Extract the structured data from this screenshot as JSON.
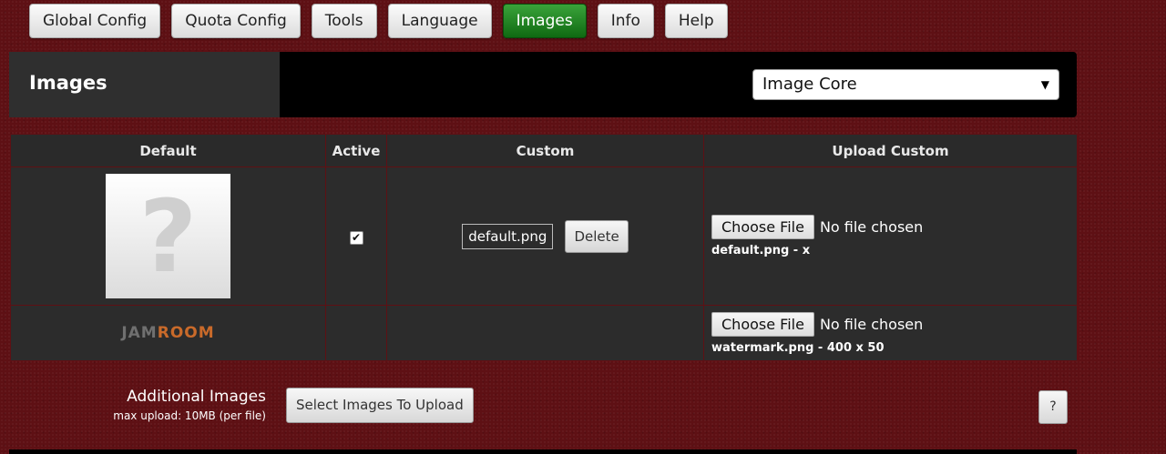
{
  "tabs": [
    {
      "label": "Global Config",
      "active": false
    },
    {
      "label": "Quota Config",
      "active": false
    },
    {
      "label": "Tools",
      "active": false
    },
    {
      "label": "Language",
      "active": false
    },
    {
      "label": "Images",
      "active": true
    },
    {
      "label": "Info",
      "active": false
    },
    {
      "label": "Help",
      "active": false
    }
  ],
  "header": {
    "title": "Images",
    "module_select_value": "Image Core"
  },
  "table": {
    "columns": [
      "Default",
      "Active",
      "Custom",
      "Upload Custom"
    ],
    "rows": [
      {
        "default_icon": "question-mark-icon",
        "default_text": "?",
        "active_check": "✔",
        "custom_image_alt": "default.png",
        "delete_label": "Delete",
        "choose_label": "Choose File",
        "no_file": "No file chosen",
        "file_info": "default.png - x"
      },
      {
        "logo_part1": "JAM",
        "logo_part2": "ROOM",
        "choose_label": "Choose File",
        "no_file": "No file chosen",
        "file_info": "watermark.png - 400 x 50"
      }
    ]
  },
  "additional": {
    "label": "Additional Images",
    "sub": "max upload: 10MB (per file)",
    "button": "Select Images To Upload",
    "help": "?"
  },
  "colors": {
    "background": "#5e1014",
    "active_tab": "#0f6a12",
    "panel": "#2c2c2c"
  }
}
